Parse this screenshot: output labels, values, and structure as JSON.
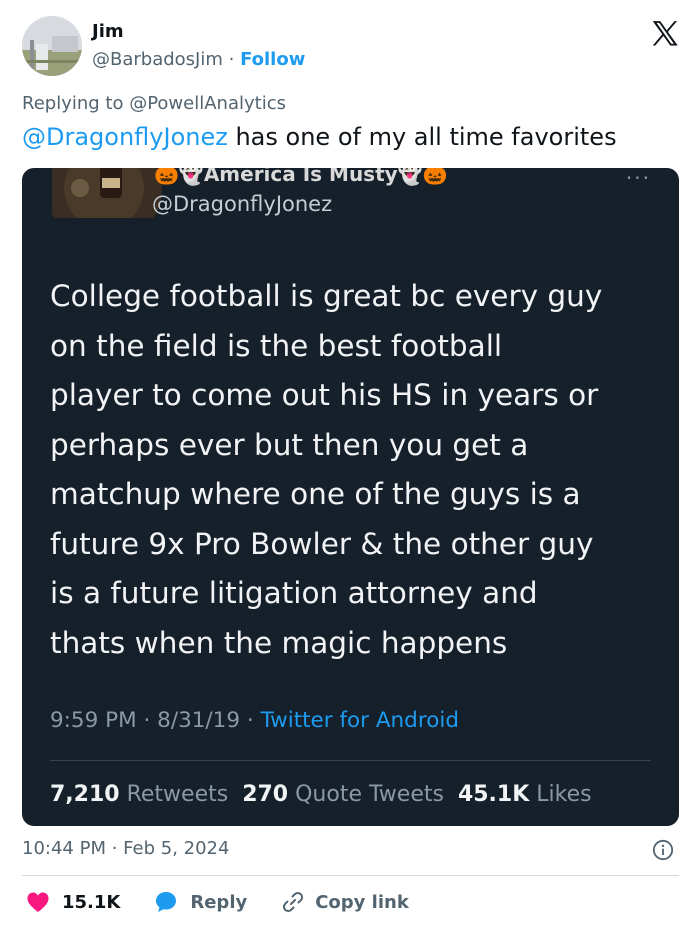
{
  "author": {
    "name": "Jim",
    "handle": "@BarbadosJim",
    "separator": " · ",
    "follow_label": "Follow"
  },
  "reply_context": {
    "prefix": "Replying to ",
    "mention": "@PowellAnalytics"
  },
  "tweet": {
    "mention": "@DragonflyJonez",
    "text": " has one of my all time favorites"
  },
  "embedded_tweet": {
    "display_name": "America Is Musty",
    "handle": "@DragonflyJonez",
    "more": "···",
    "body": "College football is great bc every guy\non the field is the best football\nplayer to come out his HS in years or\nperhaps ever but then you get a\nmatchup where one of the guys is a\nfuture 9x Pro Bowler & the other guy\nis a future litigation attorney and\nthats when the magic happens",
    "time": "9:59 PM",
    "date": "8/31/19",
    "meta_sep": " · ",
    "source": "Twitter for Android",
    "retweets_count": "7,210",
    "retweets_label": " Retweets  ",
    "quotes_count": "270",
    "quotes_label": " Quote Tweets  ",
    "likes_count": "45.1K",
    "likes_label": " Likes"
  },
  "timestamp": "10:44 PM · Feb 5, 2024",
  "actions": {
    "likes": "15.1K",
    "reply": "Reply",
    "copy_link": "Copy link"
  },
  "icons": {
    "logo": "x-logo-icon",
    "info": "info-icon",
    "like": "heart-icon",
    "reply": "speech-bubble-icon",
    "copy": "link-icon"
  },
  "colors": {
    "accent": "#1d9bf0",
    "like": "#f91880",
    "embed_bg": "#15202b",
    "text_secondary": "#536471"
  }
}
